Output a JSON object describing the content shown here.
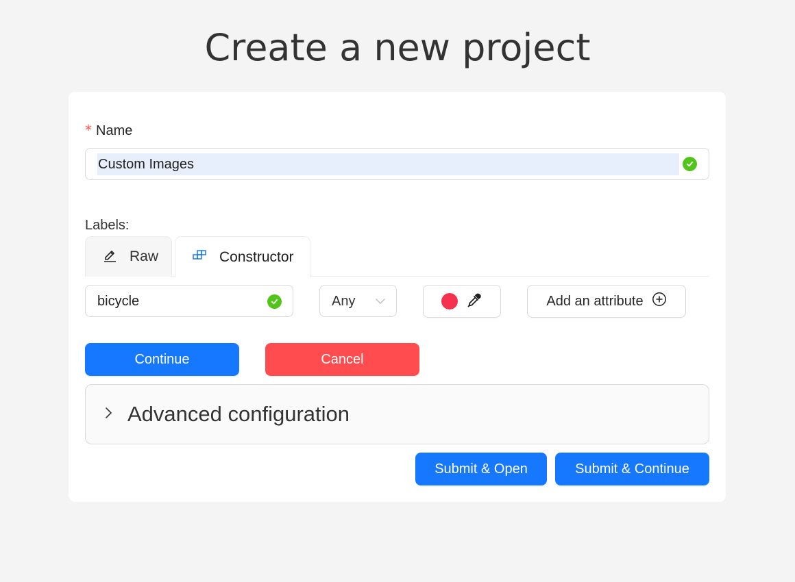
{
  "page": {
    "title": "Create a new project"
  },
  "form": {
    "name": {
      "required_mark": "*",
      "label": "Name",
      "value": "Custom Images",
      "status_icon": "check-circle-icon"
    },
    "labels": {
      "title": "Labels:",
      "tabs": [
        {
          "label": "Raw",
          "icon": "edit-icon",
          "active": false
        },
        {
          "label": "Constructor",
          "icon": "build-icon",
          "active": true
        }
      ],
      "label_row": {
        "name_value": "bicycle",
        "type_value": "Any",
        "color": "#f5314f",
        "color_icon": "eyedropper-icon",
        "add_attribute_label": "Add an attribute",
        "add_attribute_icon": "plus-circle-icon"
      }
    },
    "buttons": {
      "continue": "Continue",
      "cancel": "Cancel",
      "submit_open": "Submit & Open",
      "submit_continue": "Submit & Continue"
    },
    "advanced": {
      "title": "Advanced configuration",
      "expanded": false
    }
  },
  "colors": {
    "primary": "#1677ff",
    "danger": "#ff4d4f",
    "success": "#52c41a",
    "selection": "#e8effc"
  }
}
